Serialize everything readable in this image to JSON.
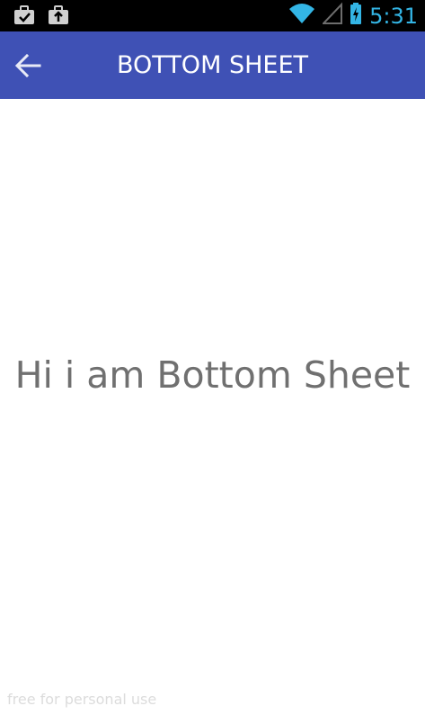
{
  "status_bar": {
    "time": "5:31",
    "icons": [
      "briefcase-check-icon",
      "briefcase-upload-icon",
      "wifi-icon",
      "signal-icon",
      "battery-charging-icon"
    ],
    "accent_color": "#33b5e5"
  },
  "app_bar": {
    "title": "BOTTOM SHEET",
    "back_icon": "arrow-left-icon",
    "color": "#3f51b5"
  },
  "main": {
    "sheet_text": "Hi i am Bottom Sheet"
  },
  "watermark": "free for personal use"
}
